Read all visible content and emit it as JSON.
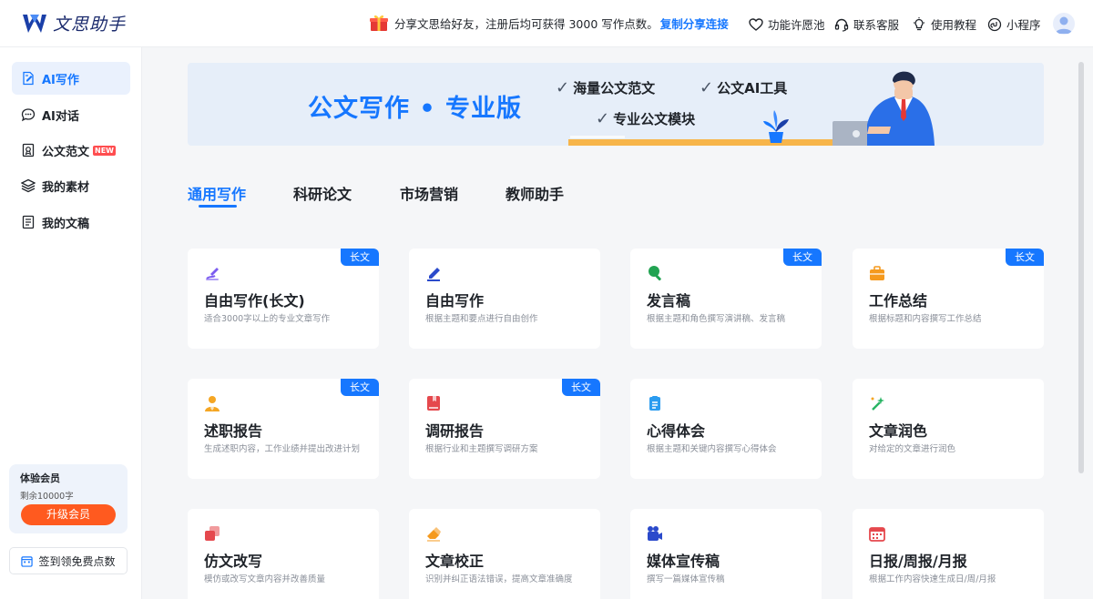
{
  "header": {
    "logo_text": "文思助手",
    "promo_text": "分享文思给好友，注册后均可获得 3000 写作点数。",
    "promo_link": "复制分享连接",
    "nav": [
      {
        "label": "功能许愿池",
        "icon": "heart-icon"
      },
      {
        "label": "联系客服",
        "icon": "headset-icon"
      },
      {
        "label": "使用教程",
        "icon": "lightbulb-icon"
      },
      {
        "label": "小程序",
        "icon": "mini-program-icon"
      }
    ]
  },
  "sidebar": {
    "items": [
      {
        "label": "AI写作",
        "icon": "edit-doc-icon",
        "active": true
      },
      {
        "label": "AI对话",
        "icon": "chat-bubble-icon"
      },
      {
        "label": "公文范文",
        "icon": "badge-doc-icon",
        "badge": "NEW"
      },
      {
        "label": "我的素材",
        "icon": "layers-icon"
      },
      {
        "label": "我的文稿",
        "icon": "document-icon"
      }
    ],
    "member": {
      "title": "体验会员",
      "remaining": "剩余10000字",
      "upgrade": "升级会员"
    },
    "signin": "签到领免费点数"
  },
  "banner": {
    "title": "公文写作 • 专业版",
    "features": [
      "海量公文范文",
      "公文AI工具",
      "专业公文模块"
    ]
  },
  "tabs": [
    "通用写作",
    "科研论文",
    "市场营销",
    "教师助手"
  ],
  "cards": [
    {
      "title": "自由写作(长文)",
      "desc": "适合3000字以上的专业文章写作",
      "tag": "长文",
      "icon": "pen-icon",
      "color": "#7b5cf0"
    },
    {
      "title": "自由写作",
      "desc": "根据主题和要点进行自由创作",
      "tag": "",
      "icon": "pencil-icon",
      "color": "#2b4acb"
    },
    {
      "title": "发言稿",
      "desc": "根据主题和角色撰写演讲稿、发言稿",
      "tag": "长文",
      "icon": "microphone-icon",
      "color": "#22a352"
    },
    {
      "title": "工作总结",
      "desc": "根据标题和内容撰写工作总结",
      "tag": "长文",
      "icon": "briefcase-icon",
      "color": "#f59a1e"
    },
    {
      "title": "述职报告",
      "desc": "生成述职内容，工作业绩并提出改进计划",
      "tag": "长文",
      "icon": "person-icon",
      "color": "#f5a623"
    },
    {
      "title": "调研报告",
      "desc": "根据行业和主题撰写调研方案",
      "tag": "长文",
      "icon": "book-icon",
      "color": "#e5484d"
    },
    {
      "title": "心得体会",
      "desc": "根据主题和关键内容撰写心得体会",
      "tag": "",
      "icon": "clipboard-icon",
      "color": "#2b9cf0"
    },
    {
      "title": "文章润色",
      "desc": "对给定的文章进行润色",
      "tag": "",
      "icon": "magic-wand-icon",
      "color": "#28b463"
    },
    {
      "title": "仿文改写",
      "desc": "模仿或改写文章内容并改善质量",
      "tag": "",
      "icon": "copy-icon",
      "color": "#e5484d"
    },
    {
      "title": "文章校正",
      "desc": "识别并纠正语法错误，提高文章准确度",
      "tag": "",
      "icon": "eraser-icon",
      "color": "#f59a1e"
    },
    {
      "title": "媒体宣传稿",
      "desc": "撰写一篇媒体宣传稿",
      "tag": "",
      "icon": "video-camera-icon",
      "color": "#2b4acb"
    },
    {
      "title": "日报/周报/月报",
      "desc": "根据工作内容快速生成日/周/月报",
      "tag": "",
      "icon": "calendar-icon",
      "color": "#e5484d"
    }
  ]
}
